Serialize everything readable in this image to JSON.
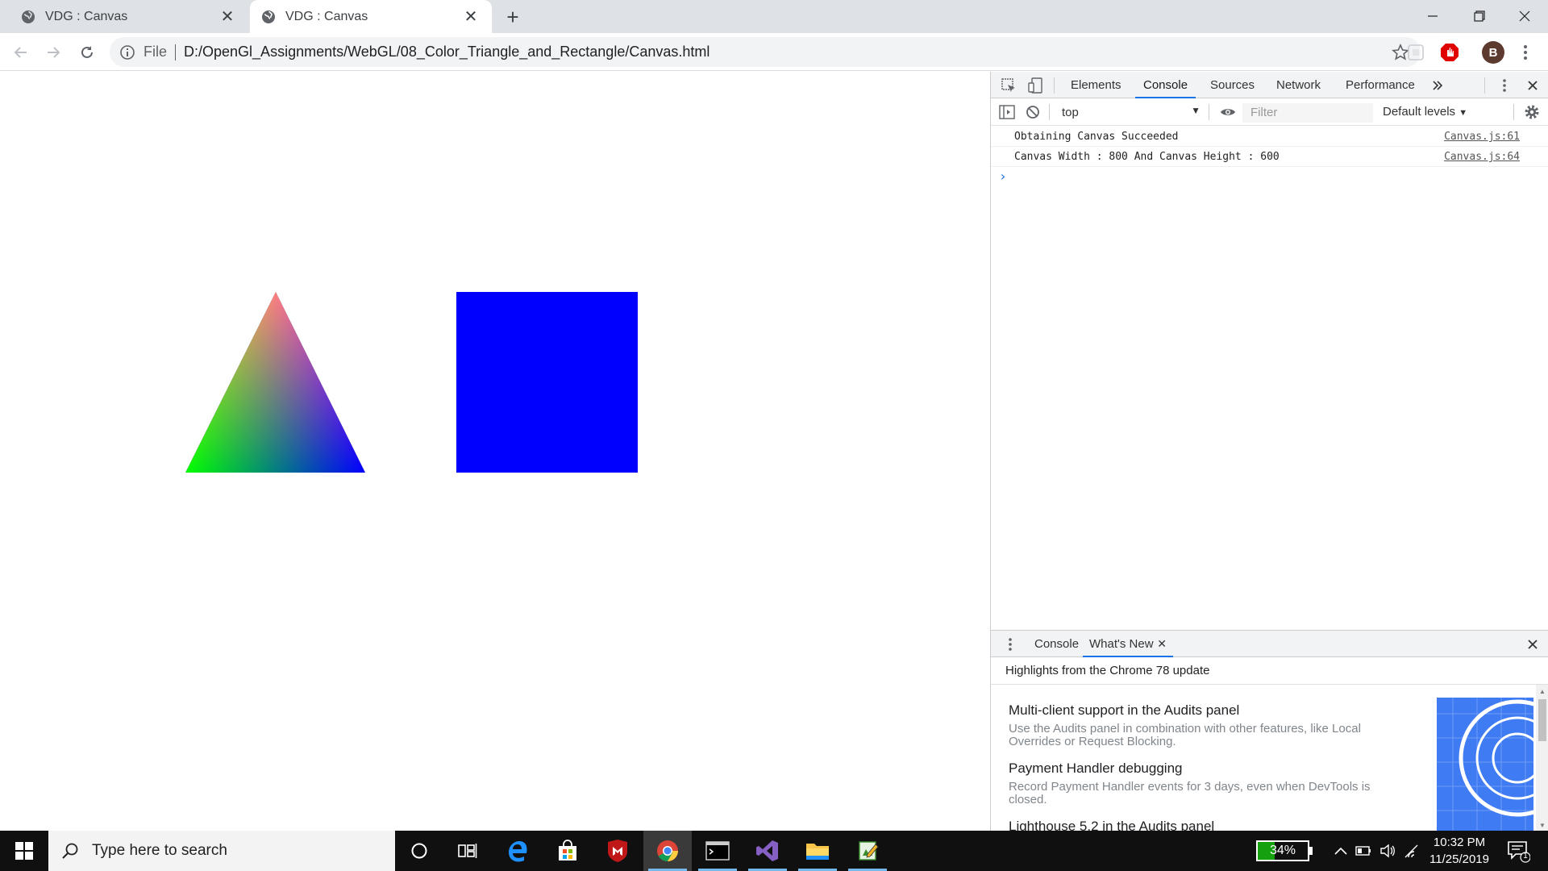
{
  "browser": {
    "tabs": [
      {
        "title": "VDG : Canvas",
        "active": false
      },
      {
        "title": "VDG : Canvas",
        "active": true
      }
    ],
    "omnibox": {
      "scheme_label": "File",
      "url": "D:/OpenGl_Assignments/WebGL/08_Color_Triangle_and_Rectangle/Canvas.html"
    },
    "profile_initial": "B"
  },
  "canvas": {
    "background": "#ffffff",
    "triangle": {
      "vertex_colors": {
        "top": "#ff0000",
        "left": "#00ff00",
        "right": "#0000ff"
      }
    },
    "rectangle": {
      "color": "#0000ff"
    }
  },
  "devtools": {
    "tabs": [
      "Elements",
      "Console",
      "Sources",
      "Network",
      "Performance"
    ],
    "selected_tab": "Console",
    "console_toolbar": {
      "context": "top",
      "filter_placeholder": "Filter",
      "levels": "Default levels"
    },
    "logs": [
      {
        "message": "Obtaining Canvas Succeeded",
        "source": "Canvas.js:61"
      },
      {
        "message": "Canvas Width : 800 And Canvas Height : 600",
        "source": "Canvas.js:64"
      }
    ],
    "drawer": {
      "tabs": [
        "Console",
        "What's New"
      ],
      "selected_tab": "What's New",
      "header": "Highlights from the Chrome 78 update",
      "items": [
        {
          "title": "Multi-client support in the Audits panel",
          "desc": "Use the Audits panel in combination with other features, like Local Overrides or Request Blocking."
        },
        {
          "title": "Payment Handler debugging",
          "desc": "Record Payment Handler events for 3 days, even when DevTools is closed."
        },
        {
          "title": "Lighthouse 5.2 in the Audits panel",
          "desc": ""
        }
      ]
    }
  },
  "taskbar": {
    "search_placeholder": "Type here to search",
    "battery_percent": "34%",
    "battery_level": 0.34,
    "time": "10:32 PM",
    "date": "11/25/2019",
    "notification_count": "1"
  }
}
